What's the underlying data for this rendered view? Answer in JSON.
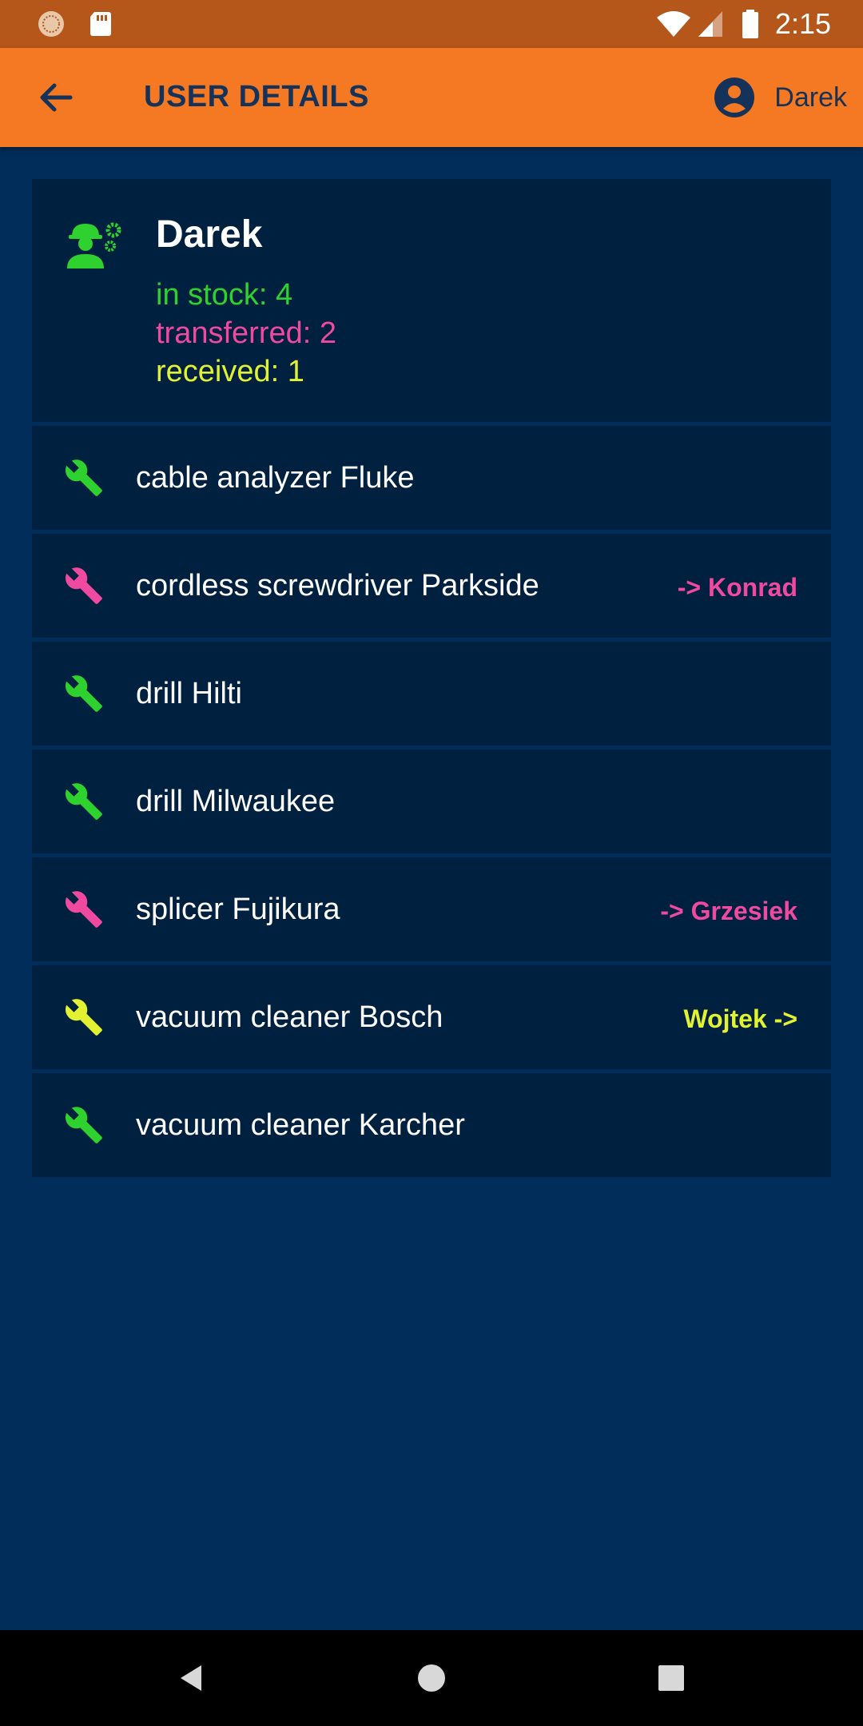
{
  "status_bar": {
    "time": "2:15",
    "icons": [
      "launcher-icon",
      "sd-card-icon",
      "wifi-icon",
      "signal-icon",
      "battery-icon"
    ]
  },
  "app_bar": {
    "title": "USER DETAILS",
    "account_name": "Darek",
    "icons": [
      "back-arrow-icon",
      "account-circle-icon"
    ]
  },
  "user": {
    "name": "Darek",
    "in_stock": "in stock: 4",
    "transferred": "transferred: 2",
    "received": "received: 1",
    "icon": "worker-gear-icon"
  },
  "tools": [
    {
      "name": "cable analyzer Fluke",
      "tag": "",
      "status": "in_stock"
    },
    {
      "name": "cordless screwdriver Parkside",
      "tag": "-> Konrad",
      "status": "transferred"
    },
    {
      "name": "drill Hilti",
      "tag": "",
      "status": "in_stock"
    },
    {
      "name": "drill Milwaukee",
      "tag": "",
      "status": "in_stock"
    },
    {
      "name": "splicer Fujikura",
      "tag": "-> Grzesiek",
      "status": "transferred"
    },
    {
      "name": "vacuum cleaner Bosch",
      "tag": "Wojtek ->",
      "status": "received"
    },
    {
      "name": "vacuum cleaner Karcher",
      "tag": "",
      "status": "in_stock"
    }
  ],
  "colors": {
    "status_bar": "#b5561a",
    "app_bar": "#f47922",
    "background": "#002d5a",
    "card": "#002040",
    "in_stock": "#2ed12e",
    "transferred": "#ef4aa0",
    "received": "#e2f232"
  },
  "nav_bar": {
    "buttons": [
      "back-triangle-icon",
      "home-circle-icon",
      "recents-square-icon"
    ]
  }
}
